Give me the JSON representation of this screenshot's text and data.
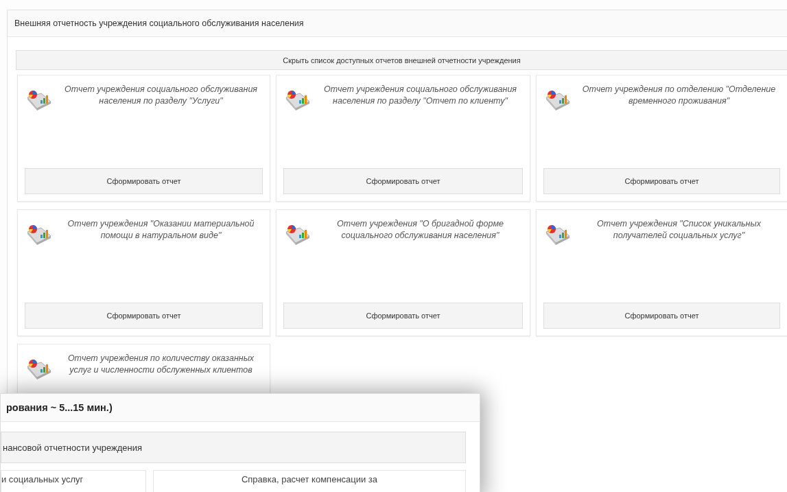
{
  "main_panel": {
    "title": "Внешняя отчетность учреждения социального обслуживания населения",
    "toggle_button": "Скрыть список доступных отчетов внешней отчетности учреждения",
    "reports": [
      {
        "title": "Отчет учреждения социального обслуживания населения по разделу \"Услуги\"",
        "button": "Сформировать отчет"
      },
      {
        "title": "Отчет учреждения социального обслуживания населения по разделу \"Отчет по клиенту\"",
        "button": "Сформировать отчет"
      },
      {
        "title": "Отчет учреждения по отделению \"Отделение временного проживания\"",
        "button": "Сформировать отчет"
      },
      {
        "title": "Отчет учреждения \"Оказании материальной помощи в натуральном виде\"",
        "button": "Сформировать отчет"
      },
      {
        "title": "Отчет учреждения \"О бригадной форме социального обслуживания населения\"",
        "button": "Сформировать отчет"
      },
      {
        "title": "Отчет учреждения \"Список уникальных получателей социальных услуг\"",
        "button": "Сформировать отчет"
      },
      {
        "title": "Отчет учреждения по количеству оказанных услуг и численности обслуженных клиентов"
      }
    ]
  },
  "overlay_panel": {
    "title": "рования ~ 5...15 мин.)",
    "toggle_button": "нансовой отчетности учреждения",
    "reports": [
      {
        "title": "и социальных услуг"
      },
      {
        "title": "Справка, расчет компенсации за"
      }
    ]
  }
}
